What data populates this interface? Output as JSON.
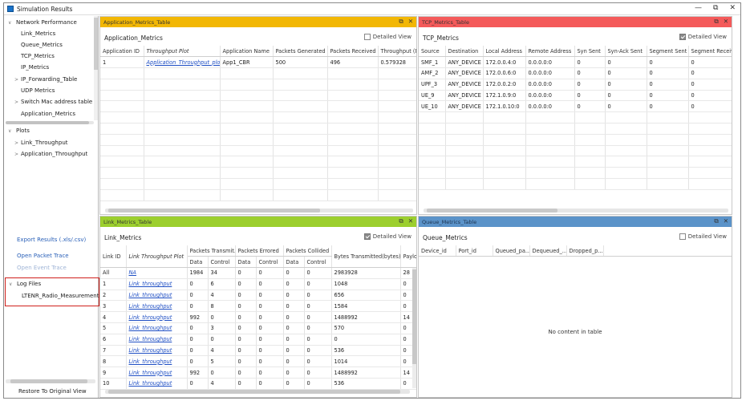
{
  "window": {
    "title": "Simulation Results",
    "min": "—",
    "max": "⧉",
    "close": "✕"
  },
  "sidebar": {
    "tree": [
      {
        "label": "Network Performance",
        "caret": "∨"
      },
      {
        "label": "Link_Metrics",
        "caret": ""
      },
      {
        "label": "Queue_Metrics",
        "caret": ""
      },
      {
        "label": "TCP_Metrics",
        "caret": ""
      },
      {
        "label": "IP_Metrics",
        "caret": ""
      },
      {
        "label": "IP_Forwarding_Table",
        "caret": ">"
      },
      {
        "label": "UDP Metrics",
        "caret": ""
      },
      {
        "label": "Switch Mac address table",
        "caret": ">"
      },
      {
        "label": "Application_Metrics",
        "caret": ""
      }
    ],
    "plots": [
      {
        "label": "Plots",
        "caret": "∨"
      },
      {
        "label": "Link_Throughput",
        "caret": ">"
      },
      {
        "label": "Application_Throughput",
        "caret": ">"
      }
    ],
    "export": "Export Results (.xls/.csv)",
    "packet_trace": "Open Packet Trace",
    "event_trace": "Open Event Trace",
    "log_files": {
      "label": "Log Files",
      "caret": "∨",
      "child": "LTENR_Radio_Measurements"
    },
    "restore": "Restore To Original View"
  },
  "app": {
    "header": "Application_Metrics_Table",
    "title": "Application_Metrics",
    "detailed": "Detailed View",
    "color": "#f2b705",
    "columns": [
      "Application ID",
      "Throughput Plot",
      "Application Name",
      "Packets Generated",
      "Packets Received",
      "Throughput (M"
    ],
    "rows": [
      [
        "1",
        "Application_Throughput_plot",
        "App1_CBR",
        "500",
        "496",
        "0.579328"
      ]
    ]
  },
  "tcp": {
    "header": "TCP_Metrics_Table",
    "title": "TCP_Metrics",
    "detailed": "Detailed View",
    "color": "#f45a5a",
    "columns": [
      "Source",
      "Destination",
      "Local Address",
      "Remote Address",
      "Syn Sent",
      "Syn-Ack Sent",
      "Segment Sent",
      "Segment Receive"
    ],
    "rows": [
      [
        "SMF_1",
        "ANY_DEVICE",
        "172.0.0.4:0",
        "0.0.0.0:0",
        "0",
        "0",
        "0",
        "0"
      ],
      [
        "AMF_2",
        "ANY_DEVICE",
        "172.0.0.6:0",
        "0.0.0.0:0",
        "0",
        "0",
        "0",
        "0"
      ],
      [
        "UPF_3",
        "ANY_DEVICE",
        "172.0.0.2:0",
        "0.0.0.0:0",
        "0",
        "0",
        "0",
        "0"
      ],
      [
        "UE_9",
        "ANY_DEVICE",
        "172.1.0.9:0",
        "0.0.0.0:0",
        "0",
        "0",
        "0",
        "0"
      ],
      [
        "UE_10",
        "ANY_DEVICE",
        "172.1.0.10:0",
        "0.0.0.0:0",
        "0",
        "0",
        "0",
        "0"
      ]
    ]
  },
  "link": {
    "header": "Link_Metrics_Table",
    "title": "Link_Metrics",
    "detailed": "Detailed View",
    "color": "#9ccf2e",
    "col_link": "Link ID",
    "col_plot": "Link Throughput Plot",
    "groups": [
      "Packets Transmit...",
      "Packets Errored",
      "Packets Collided"
    ],
    "sub": [
      "Data",
      "Control",
      "Data",
      "Control",
      "Data",
      "Control"
    ],
    "col_bytes": "Bytes Transmitted(bytes)",
    "col_payload": "Paylo",
    "rows": [
      [
        "All",
        "NA",
        "1984",
        "34",
        "0",
        "0",
        "0",
        "0",
        "2983928",
        "28"
      ],
      [
        "1",
        "Link_throughput",
        "0",
        "6",
        "0",
        "0",
        "0",
        "0",
        "1048",
        "0"
      ],
      [
        "2",
        "Link_throughput",
        "0",
        "4",
        "0",
        "0",
        "0",
        "0",
        "656",
        "0"
      ],
      [
        "3",
        "Link_throughput",
        "0",
        "8",
        "0",
        "0",
        "0",
        "0",
        "1584",
        "0"
      ],
      [
        "4",
        "Link_throughput",
        "992",
        "0",
        "0",
        "0",
        "0",
        "0",
        "1488992",
        "14"
      ],
      [
        "5",
        "Link_throughput",
        "0",
        "3",
        "0",
        "0",
        "0",
        "0",
        "570",
        "0"
      ],
      [
        "6",
        "Link_throughput",
        "0",
        "0",
        "0",
        "0",
        "0",
        "0",
        "0",
        "0"
      ],
      [
        "7",
        "Link_throughput",
        "0",
        "4",
        "0",
        "0",
        "0",
        "0",
        "536",
        "0"
      ],
      [
        "8",
        "Link_throughput",
        "0",
        "5",
        "0",
        "0",
        "0",
        "0",
        "1014",
        "0"
      ],
      [
        "9",
        "Link_throughput",
        "992",
        "0",
        "0",
        "0",
        "0",
        "0",
        "1488992",
        "14"
      ],
      [
        "10",
        "Link_throughput",
        "0",
        "4",
        "0",
        "0",
        "0",
        "0",
        "536",
        "0"
      ]
    ]
  },
  "queue": {
    "header": "Queue_Metrics_Table",
    "title": "Queue_Metrics",
    "detailed": "Detailed View",
    "color": "#5b93c9",
    "columns": [
      "Device_id",
      "Port_id",
      "Queued_pa...",
      "Dequeued_...",
      "Dropped_p..."
    ],
    "empty": "No content in table"
  }
}
